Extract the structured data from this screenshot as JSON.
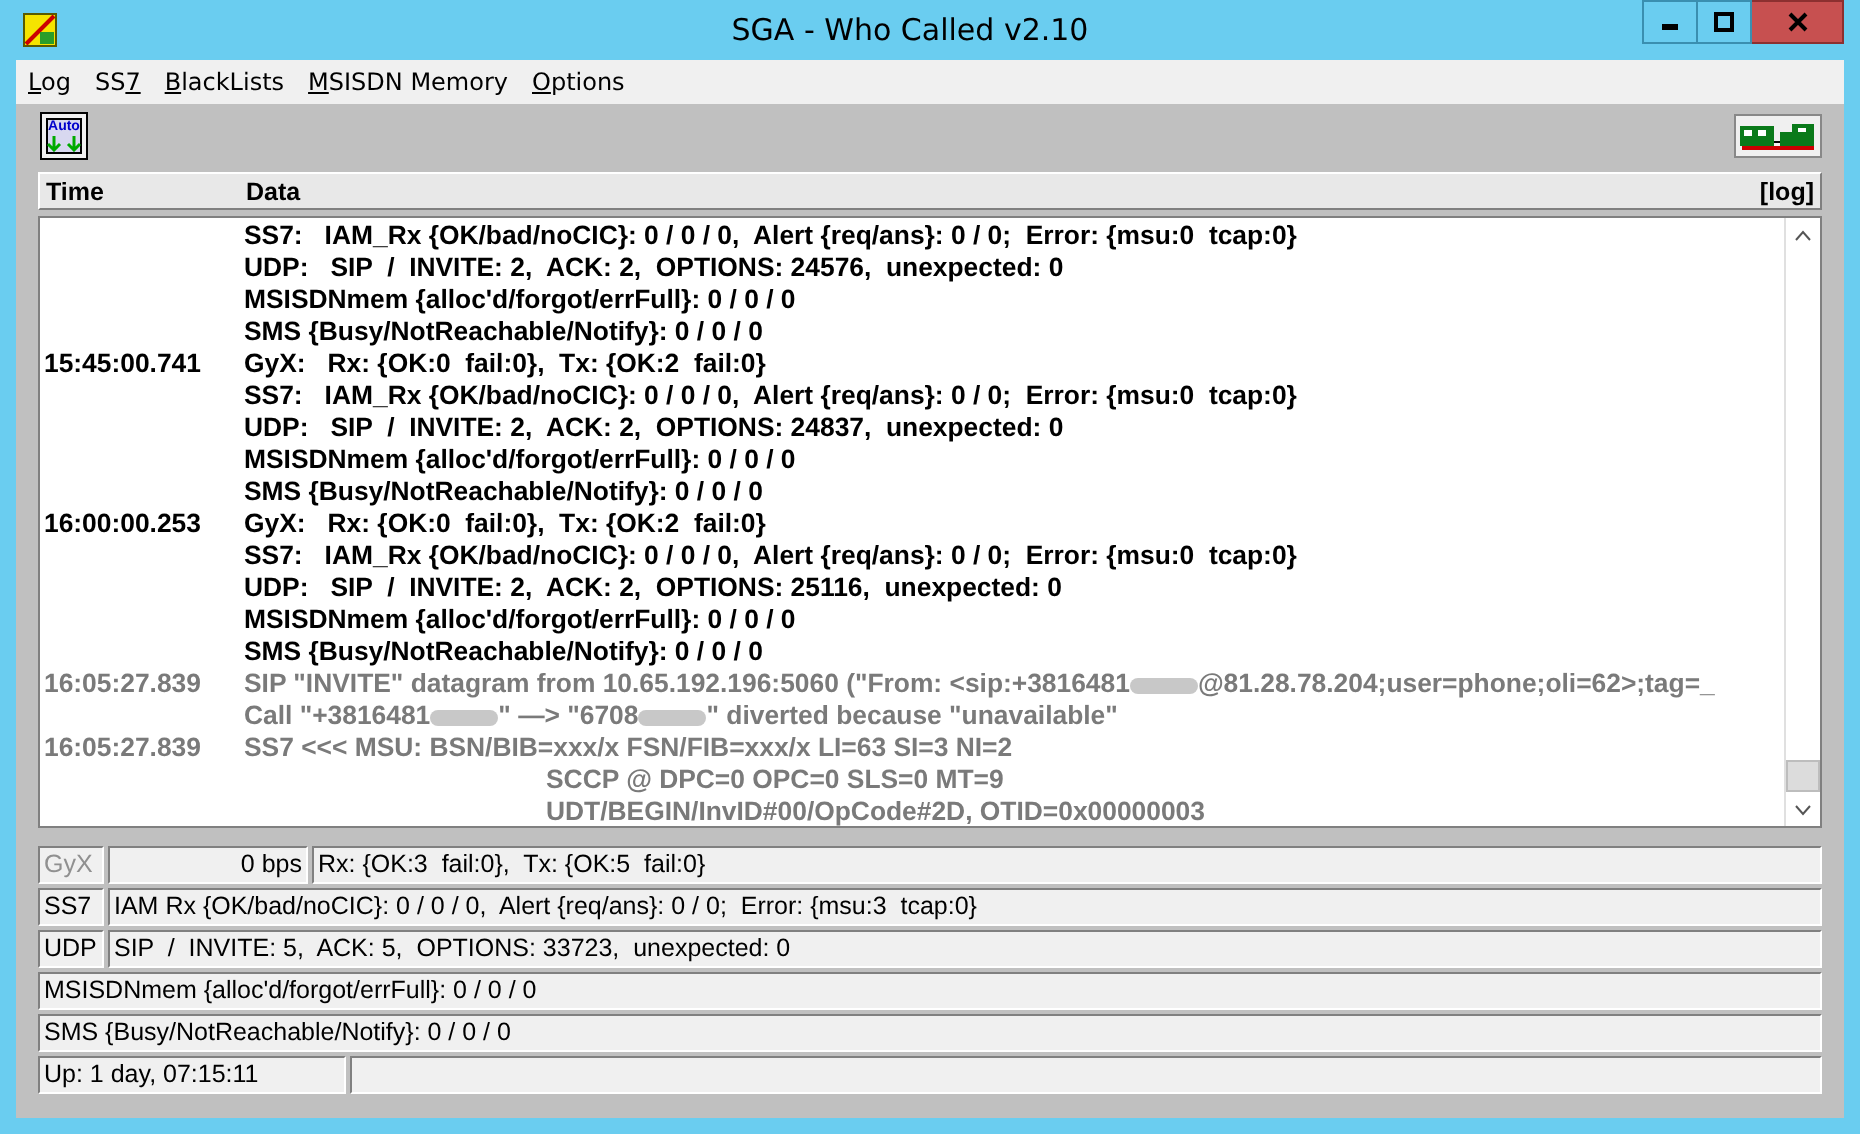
{
  "window": {
    "title": "SGA - Who Called  v2.10"
  },
  "menu": [
    {
      "underlined": "L",
      "after": "og"
    },
    {
      "before": "SS",
      "underlined": "7"
    },
    {
      "underlined": "B",
      "after": "lackLists"
    },
    {
      "underlined": "M",
      "after": "SISDN Memory"
    },
    {
      "underlined": "O",
      "after": "ptions"
    }
  ],
  "toolbar": {
    "auto_button": {
      "label": "Auto"
    }
  },
  "log": {
    "columns": [
      "Time",
      "Data"
    ],
    "header_right": "[log]",
    "rows": [
      {
        "time": "",
        "dim": false,
        "parts": [
          {
            "kind": "text",
            "text": "SS7:   IAM_Rx {OK/bad/noCIC}: 0 / 0 / 0,  Alert {req/ans}: 0 / 0;  Error: {msu:0  tcap:0}"
          }
        ]
      },
      {
        "time": "",
        "dim": false,
        "parts": [
          {
            "kind": "text",
            "text": "UDP:   SIP  /  INVITE: 2,  ACK: 2,  OPTIONS: 24576,  unexpected: 0"
          }
        ]
      },
      {
        "time": "",
        "dim": false,
        "parts": [
          {
            "kind": "text",
            "text": "MSISDNmem {alloc'd/forgot/errFull}: 0 / 0 / 0"
          }
        ]
      },
      {
        "time": "",
        "dim": false,
        "parts": [
          {
            "kind": "text",
            "text": "SMS {Busy/NotReachable/Notify}: 0 / 0 / 0"
          }
        ]
      },
      {
        "time": "15:45:00.741",
        "dim": false,
        "parts": [
          {
            "kind": "text",
            "text": "GyX:   Rx: {OK:0  fail:0},  Tx: {OK:2  fail:0}"
          }
        ]
      },
      {
        "time": "",
        "dim": false,
        "parts": [
          {
            "kind": "text",
            "text": "SS7:   IAM_Rx {OK/bad/noCIC}: 0 / 0 / 0,  Alert {req/ans}: 0 / 0;  Error: {msu:0  tcap:0}"
          }
        ]
      },
      {
        "time": "",
        "dim": false,
        "parts": [
          {
            "kind": "text",
            "text": "UDP:   SIP  /  INVITE: 2,  ACK: 2,  OPTIONS: 24837,  unexpected: 0"
          }
        ]
      },
      {
        "time": "",
        "dim": false,
        "parts": [
          {
            "kind": "text",
            "text": "MSISDNmem {alloc'd/forgot/errFull}: 0 / 0 / 0"
          }
        ]
      },
      {
        "time": "",
        "dim": false,
        "parts": [
          {
            "kind": "text",
            "text": "SMS {Busy/NotReachable/Notify}: 0 / 0 / 0"
          }
        ]
      },
      {
        "time": "16:00:00.253",
        "dim": false,
        "parts": [
          {
            "kind": "text",
            "text": "GyX:   Rx: {OK:0  fail:0},  Tx: {OK:2  fail:0}"
          }
        ]
      },
      {
        "time": "",
        "dim": false,
        "parts": [
          {
            "kind": "text",
            "text": "SS7:   IAM_Rx {OK/bad/noCIC}: 0 / 0 / 0,  Alert {req/ans}: 0 / 0;  Error: {msu:0  tcap:0}"
          }
        ]
      },
      {
        "time": "",
        "dim": false,
        "parts": [
          {
            "kind": "text",
            "text": "UDP:   SIP  /  INVITE: 2,  ACK: 2,  OPTIONS: 25116,  unexpected: 0"
          }
        ]
      },
      {
        "time": "",
        "dim": false,
        "parts": [
          {
            "kind": "text",
            "text": "MSISDNmem {alloc'd/forgot/errFull}: 0 / 0 / 0"
          }
        ]
      },
      {
        "time": "",
        "dim": false,
        "parts": [
          {
            "kind": "text",
            "text": "SMS {Busy/NotReachable/Notify}: 0 / 0 / 0"
          }
        ]
      },
      {
        "time": "16:05:27.839",
        "dim": true,
        "parts": [
          {
            "kind": "text",
            "text": "SIP \"INVITE\" datagram from 10.65.192.196:5060 (\"From: <sip:+3816481"
          },
          {
            "kind": "redacted"
          },
          {
            "kind": "text",
            "text": "@81.28.78.204;user=phone;oli=62>;tag=_"
          }
        ]
      },
      {
        "time": "",
        "dim": true,
        "parts": [
          {
            "kind": "text",
            "text": "Call \"+3816481"
          },
          {
            "kind": "redacted"
          },
          {
            "kind": "text",
            "text": "\" —> \"6708"
          },
          {
            "kind": "redacted"
          },
          {
            "kind": "text",
            "text": "\" diverted because \"unavailable\""
          }
        ]
      },
      {
        "time": "16:05:27.839",
        "dim": true,
        "parts": [
          {
            "kind": "text",
            "text": "SS7 <<< MSU: BSN/BIB=xxx/x FSN/FIB=xxx/x LI=63 SI=3 NI=2"
          }
        ],
        "children": [
          {
            "text": "SCCP @ DPC=0 OPC=0 SLS=0 MT=9"
          },
          {
            "text": "UDT/BEGIN/InvID#00/OpCode#2D, OTID=0x00000003"
          }
        ]
      }
    ]
  },
  "status": {
    "gyx": {
      "label": "GyX",
      "disabled": true,
      "rate": "0 bps",
      "text": "Rx: {OK:3  fail:0},  Tx: {OK:5  fail:0}"
    },
    "ss7": {
      "label": "SS7",
      "text": "IAM Rx {OK/bad/noCIC}: 0 / 0 / 0,  Alert {req/ans}: 0 / 0;  Error: {msu:3  tcap:0}"
    },
    "udp": {
      "label": "UDP",
      "text": "SIP  /  INVITE: 5,  ACK: 5,  OPTIONS: 33723,  unexpected: 0"
    },
    "msisdn": {
      "text": "MSISDNmem {alloc'd/forgot/errFull}: 0 / 0 / 0"
    },
    "sms": {
      "text": "SMS {Busy/NotReachable/Notify}: 0 / 0 / 0"
    },
    "uptime": {
      "text": "Up: 1 day, 07:15:11"
    }
  }
}
